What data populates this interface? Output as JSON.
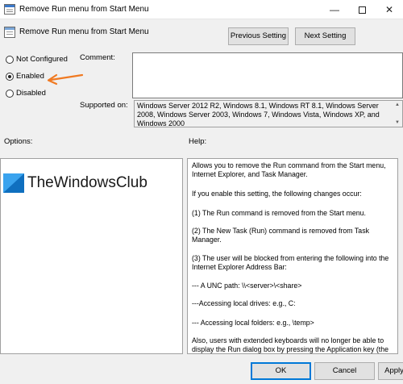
{
  "window": {
    "title": "Remove Run menu from Start Menu",
    "minimize_glyph": "—",
    "close_glyph": "✕"
  },
  "header": {
    "policy_name": "Remove Run menu from Start Menu",
    "prev_label": "Previous Setting",
    "next_label": "Next Setting"
  },
  "state": {
    "options": [
      {
        "label": "Not Configured",
        "selected": false
      },
      {
        "label": "Enabled",
        "selected": true
      },
      {
        "label": "Disabled",
        "selected": false
      }
    ],
    "arrow_color": "#f07a22"
  },
  "fields": {
    "comment_label": "Comment:",
    "comment_value": "",
    "supported_label": "Supported on:",
    "supported_value": "Windows Server 2012 R2, Windows 8.1, Windows RT 8.1, Windows Server 2008, Windows Server 2003, Windows 7, Windows Vista, Windows XP, and Windows 2000"
  },
  "panels": {
    "options_label": "Options:",
    "help_label": "Help:",
    "watermark": "TheWindowsClub",
    "help_paragraphs": [
      "Allows you to remove the Run command from the Start menu, Internet Explorer, and Task Manager.",
      "If you enable this setting, the following changes occur:",
      "(1) The Run command is removed from the Start menu.",
      "(2) The New Task (Run) command is removed from Task Manager.",
      "(3) The user will be blocked from entering the following into the Internet Explorer Address Bar:",
      "--- A UNC path: \\\\<server>\\<share>",
      "---Accessing local drives:  e.g., C:",
      "--- Accessing local folders: e.g., \\temp>",
      "Also, users with extended keyboards will no longer be able to display the Run dialog box by pressing the Application key (the"
    ]
  },
  "footer": {
    "ok_label": "OK",
    "cancel_label": "Cancel",
    "apply_label": "Apply"
  },
  "colors": {
    "accent": "#0078d7",
    "logo_blue": "#1e8fe1"
  }
}
